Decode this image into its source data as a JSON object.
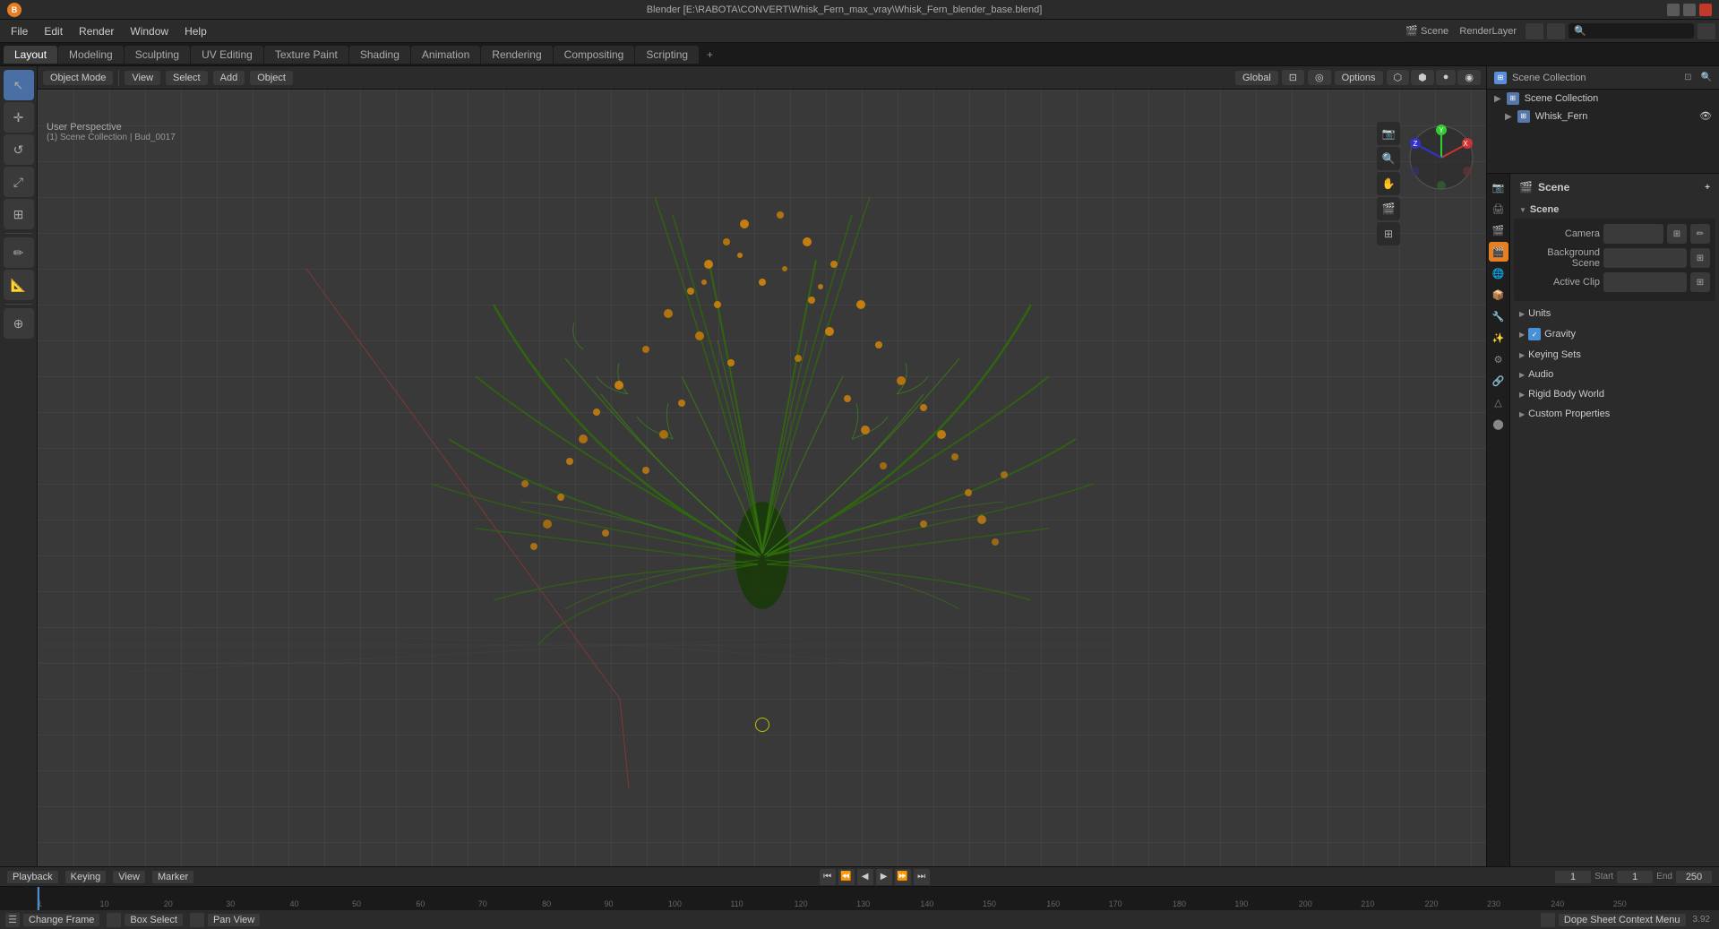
{
  "titlebar": {
    "title": "Blender [E:\\RABOTA\\CONVERT\\Whisk_Fern_max_vray\\Whisk_Fern_blender_base.blend]"
  },
  "menubar": {
    "items": [
      "Blender",
      "File",
      "Edit",
      "Render",
      "Window",
      "Help"
    ]
  },
  "workspace_tabs": {
    "tabs": [
      "Layout",
      "Modeling",
      "Sculpting",
      "UV Editing",
      "Texture Paint",
      "Shading",
      "Animation",
      "Rendering",
      "Compositing",
      "Scripting"
    ],
    "active": "Layout",
    "add_label": "+"
  },
  "viewport_header": {
    "mode_label": "Object Mode",
    "view_label": "View",
    "select_label": "Select",
    "add_label": "Add",
    "object_label": "Object",
    "global_label": "Global",
    "options_label": "Options"
  },
  "viewport_info": {
    "perspective": "User Perspective",
    "collection": "(1) Scene Collection | Bud_0017"
  },
  "outliner": {
    "title": "Scene Collection",
    "items": [
      {
        "name": "Whisk_Fern",
        "icon": "▶",
        "type": "collection"
      }
    ]
  },
  "properties": {
    "scene_label": "Scene",
    "scene_name": "Scene",
    "sections": {
      "scene": {
        "label": "Scene",
        "expanded": true,
        "camera_label": "Camera",
        "background_scene_label": "Background Scene",
        "active_clip_label": "Active Clip"
      },
      "units": {
        "label": "Units",
        "expanded": false
      },
      "gravity": {
        "label": "Gravity",
        "expanded": false,
        "checked": true
      },
      "keying_sets": {
        "label": "Keying Sets",
        "expanded": false
      },
      "audio": {
        "label": "Audio",
        "expanded": false
      },
      "rigid_body_world": {
        "label": "Rigid Body World",
        "expanded": false
      },
      "custom_properties": {
        "label": "Custom Properties",
        "expanded": false
      }
    }
  },
  "timeline": {
    "playback_label": "Playback",
    "keying_label": "Keying",
    "view_label": "View",
    "marker_label": "Marker",
    "frame_current": "1",
    "start_label": "Start",
    "start_value": "1",
    "end_label": "End",
    "end_value": "250",
    "ruler_marks": [
      "1",
      "10",
      "20",
      "30",
      "40",
      "50",
      "60",
      "70",
      "80",
      "90",
      "100",
      "110",
      "120",
      "130",
      "140",
      "150",
      "160",
      "170",
      "180",
      "190",
      "200",
      "210",
      "220",
      "230",
      "240",
      "250"
    ]
  },
  "bottom_bar": {
    "change_frame_label": "Change Frame",
    "box_select_label": "Box Select",
    "pan_view_label": "Pan View",
    "dope_sheet_label": "Dope Sheet Context Menu",
    "frame_number": "3.92"
  },
  "icons": {
    "arrow_right": "▶",
    "arrow_down": "▼",
    "search": "🔍",
    "camera": "📷",
    "film": "🎬",
    "scene": "🎬",
    "tool_cursor": "↖",
    "tool_move": "✛",
    "tool_rotate": "↺",
    "tool_scale": "⤢",
    "tool_transform": "⊞",
    "tool_annotate": "✏",
    "tool_measure": "📏",
    "tool_add": "⊕",
    "nav_zoom": "🔍",
    "nav_pan": "✋",
    "nav_camera": "📷",
    "nav_grid": "⊞"
  }
}
